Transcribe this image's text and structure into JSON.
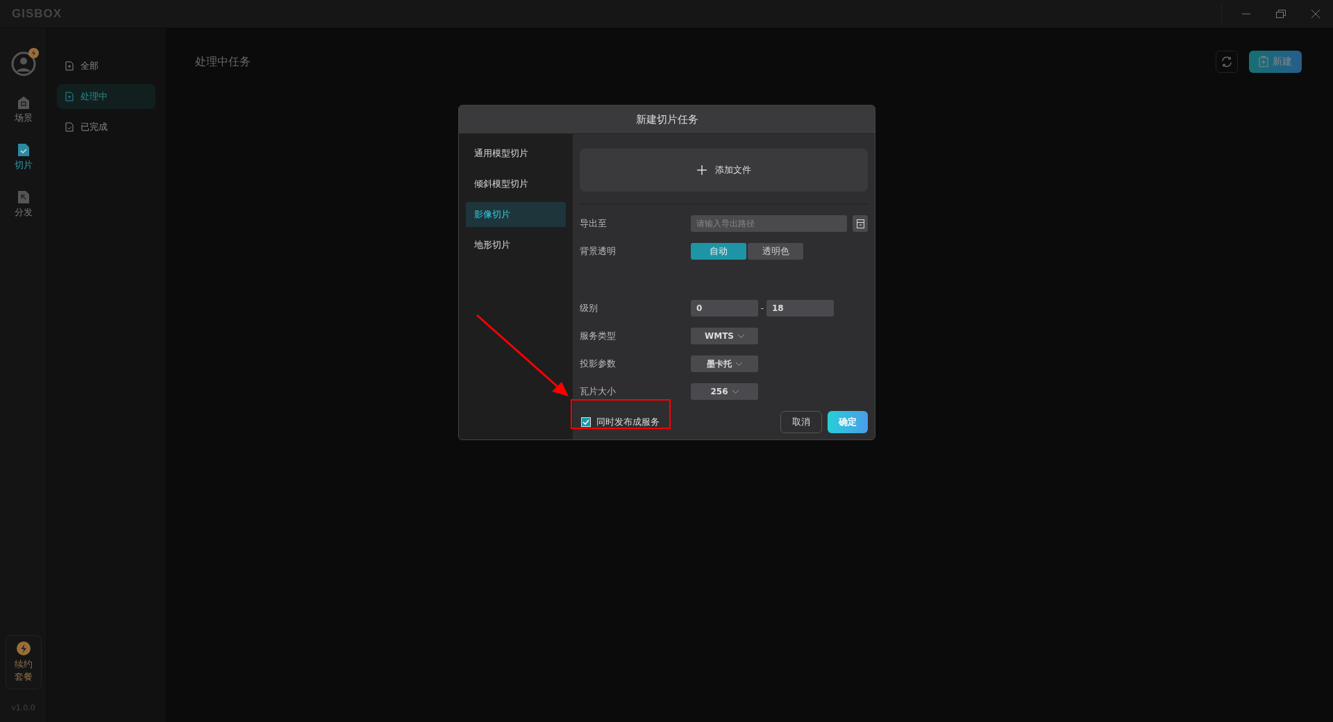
{
  "window": {
    "logo": "GISBOX"
  },
  "rail": {
    "items": [
      {
        "label": "场景",
        "selected": false
      },
      {
        "label": "切片",
        "selected": true
      },
      {
        "label": "分发",
        "selected": false
      }
    ],
    "renew": {
      "label": "续约套餐"
    },
    "version": "v1.0.0"
  },
  "sidebar": {
    "items": [
      {
        "label": "全部",
        "selected": false
      },
      {
        "label": "处理中",
        "selected": true
      },
      {
        "label": "已完成",
        "selected": false
      }
    ]
  },
  "header": {
    "title": "处理中任务",
    "new_button": "新建"
  },
  "dialog": {
    "title": "新建切片任务",
    "menu": [
      {
        "label": "通用模型切片",
        "selected": false
      },
      {
        "label": "倾斜模型切片",
        "selected": false
      },
      {
        "label": "影像切片",
        "selected": true
      },
      {
        "label": "地形切片",
        "selected": false
      }
    ],
    "add_file": "添加文件",
    "export": {
      "label": "导出至",
      "placeholder": "请输入导出路径"
    },
    "background": {
      "label": "背景透明",
      "options": [
        {
          "label": "自动",
          "selected": true
        },
        {
          "label": "透明色",
          "selected": false
        }
      ]
    },
    "level": {
      "label": "级别",
      "from": "0",
      "separator": "-",
      "to": "18"
    },
    "selects": [
      {
        "label": "服务类型",
        "value": "WMTS"
      },
      {
        "label": "投影参数",
        "value": "墨卡托"
      },
      {
        "label": "瓦片大小",
        "value": "256"
      }
    ],
    "publish": {
      "label": "同时发布成服务",
      "checked": true
    },
    "cancel": "取消",
    "ok": "确定"
  }
}
